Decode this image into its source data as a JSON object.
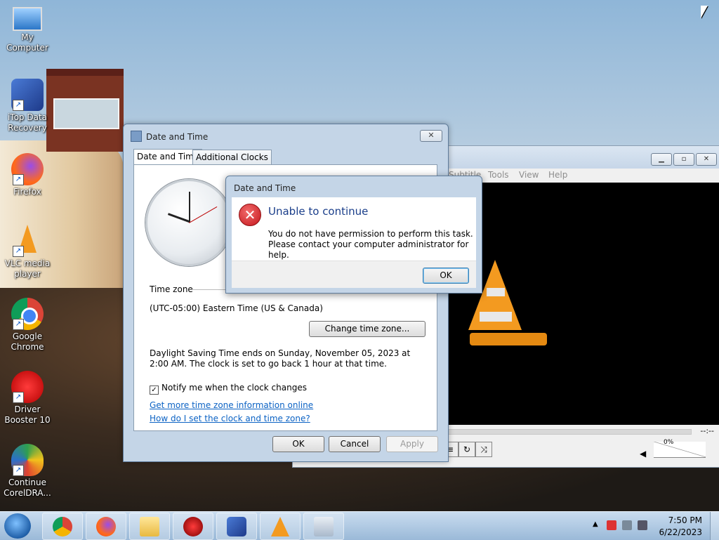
{
  "desktop": {
    "icons": [
      {
        "label": "My Computer"
      },
      {
        "label": "iTop Data Recovery"
      },
      {
        "label": "Firefox"
      },
      {
        "label": "VLC media player"
      },
      {
        "label": "Google Chrome"
      },
      {
        "label": "Driver Booster 10"
      },
      {
        "label": "Continue CorelDRA..."
      }
    ]
  },
  "vlc": {
    "menu": [
      "Subtitle",
      "Tools",
      "View",
      "Help"
    ],
    "time": "--:--",
    "volume": "0%"
  },
  "dialog": {
    "title": "Date and Time",
    "tabs": [
      "Date and Time",
      "Additional Clocks"
    ],
    "timezone_label": "Time zone",
    "timezone_value": "(UTC-05:00) Eastern Time (US & Canada)",
    "change_tz_button": "Change time zone...",
    "dst_text": "Daylight Saving Time ends on Sunday, November 05, 2023 at 2:00 AM. The clock is set to go back 1 hour at that time.",
    "notify_label": "Notify me when the clock changes",
    "notify_checked": true,
    "link1": "Get more time zone information online",
    "link2": "How do I set the clock and time zone?",
    "ok": "OK",
    "cancel": "Cancel",
    "apply": "Apply"
  },
  "error": {
    "title": "Date and Time",
    "heading": "Unable to continue",
    "line1": "You do not have permission to perform this task.",
    "line2": "Please contact your computer administrator for help.",
    "ok": "OK"
  },
  "taskbar": {
    "time": "7:50 PM",
    "date": "6/22/2023",
    "items": [
      "chrome-icon",
      "firefox-icon",
      "file-explorer-icon",
      "driver-booster-icon",
      "itop-recovery-icon",
      "vlc-icon",
      "date-time-icon"
    ]
  },
  "colors": {
    "error_heading": "#1a3e8a",
    "link": "#0b62c4",
    "vlc_orange": "#f39a20"
  }
}
